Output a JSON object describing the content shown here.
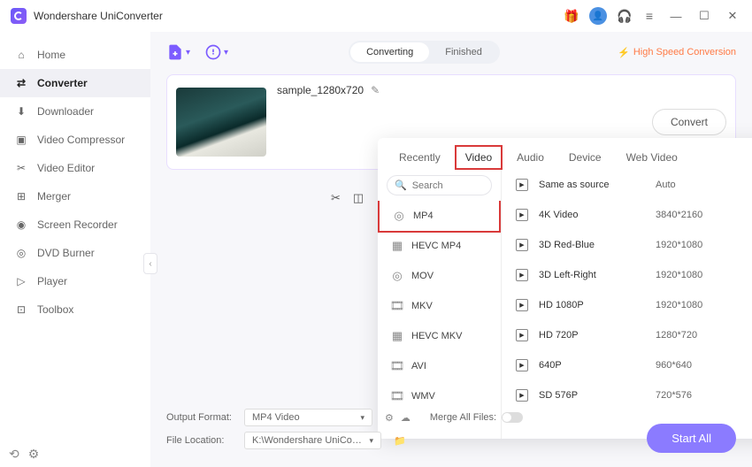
{
  "app": {
    "title": "Wondershare UniConverter"
  },
  "sidebar": {
    "items": [
      {
        "label": "Home"
      },
      {
        "label": "Converter"
      },
      {
        "label": "Downloader"
      },
      {
        "label": "Video Compressor"
      },
      {
        "label": "Video Editor"
      },
      {
        "label": "Merger"
      },
      {
        "label": "Screen Recorder"
      },
      {
        "label": "DVD Burner"
      },
      {
        "label": "Player"
      },
      {
        "label": "Toolbox"
      }
    ]
  },
  "toolbar": {
    "seg": {
      "converting": "Converting",
      "finished": "Finished"
    },
    "hsc": "High Speed Conversion"
  },
  "file": {
    "name": "sample_1280x720",
    "convert_btn": "Convert"
  },
  "popup": {
    "tabs": {
      "recently": "Recently",
      "video": "Video",
      "audio": "Audio",
      "device": "Device",
      "web": "Web Video"
    },
    "search_placeholder": "Search",
    "formats": [
      {
        "label": "MP4"
      },
      {
        "label": "HEVC MP4"
      },
      {
        "label": "MOV"
      },
      {
        "label": "MKV"
      },
      {
        "label": "HEVC MKV"
      },
      {
        "label": "AVI"
      },
      {
        "label": "WMV"
      }
    ],
    "presets": [
      {
        "name": "Same as source",
        "res": "Auto"
      },
      {
        "name": "4K Video",
        "res": "3840*2160"
      },
      {
        "name": "3D Red-Blue",
        "res": "1920*1080"
      },
      {
        "name": "3D Left-Right",
        "res": "1920*1080"
      },
      {
        "name": "HD 1080P",
        "res": "1920*1080"
      },
      {
        "name": "HD 720P",
        "res": "1280*720"
      },
      {
        "name": "640P",
        "res": "960*640"
      },
      {
        "name": "SD 576P",
        "res": "720*576"
      }
    ]
  },
  "footer": {
    "output_label": "Output Format:",
    "output_value": "MP4 Video",
    "location_label": "File Location:",
    "location_value": "K:\\Wondershare UniConverter",
    "merge_label": "Merge All Files:",
    "start_all": "Start All"
  }
}
